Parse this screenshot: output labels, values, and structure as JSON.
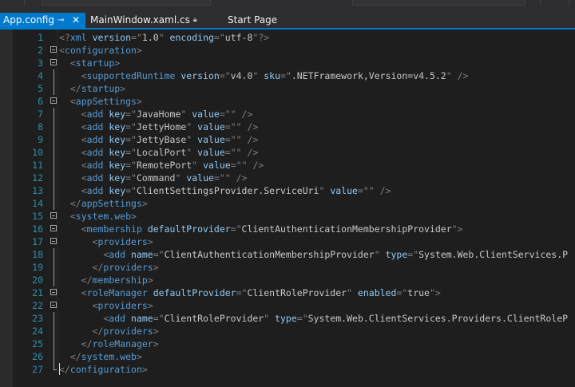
{
  "tabs": [
    {
      "label": "App.config",
      "active": true,
      "pinned": true,
      "closable": true
    },
    {
      "label": "MainWindow.xaml.cs",
      "active": false,
      "read_only": true
    },
    {
      "label": "Start Page",
      "active": false
    }
  ],
  "icons": {
    "pin": "pin-icon",
    "close": "close-icon",
    "lock": "lock-icon"
  },
  "colors": {
    "accent": "#007acc",
    "background": "#1e1e1e",
    "line_number": "#2b91af",
    "tag": "#569cd6",
    "attribute": "#92caf4",
    "delimiter": "#808080",
    "text": "#c8c8c8"
  },
  "editor": {
    "caret_line": 27,
    "lines": [
      {
        "n": "1",
        "fold": "",
        "indent": 0,
        "tokens": [
          [
            "d",
            "<?"
          ],
          [
            "t",
            "xml"
          ],
          [
            "a",
            " version"
          ],
          [
            "d",
            "=\""
          ],
          [
            "v",
            "1.0"
          ],
          [
            "d",
            "\""
          ],
          [
            "a",
            " encoding"
          ],
          [
            "d",
            "=\""
          ],
          [
            "v",
            "utf-8"
          ],
          [
            "d",
            "\"?>"
          ]
        ]
      },
      {
        "n": "2",
        "fold": "open",
        "indent": 0,
        "tokens": [
          [
            "d",
            "<"
          ],
          [
            "t",
            "configuration"
          ],
          [
            "d",
            ">"
          ]
        ]
      },
      {
        "n": "3",
        "fold": "open",
        "indent": 1,
        "tokens": [
          [
            "d",
            "<"
          ],
          [
            "t",
            "startup"
          ],
          [
            "d",
            ">"
          ]
        ]
      },
      {
        "n": "4",
        "fold": "",
        "indent": 2,
        "tokens": [
          [
            "d",
            "<"
          ],
          [
            "t",
            "supportedRuntime"
          ],
          [
            "a",
            " version"
          ],
          [
            "d",
            "=\""
          ],
          [
            "v",
            "v4.0"
          ],
          [
            "d",
            "\""
          ],
          [
            "a",
            " sku"
          ],
          [
            "d",
            "=\""
          ],
          [
            "v",
            ".NETFramework,Version=v4.5.2"
          ],
          [
            "d",
            "\" />"
          ]
        ]
      },
      {
        "n": "5",
        "fold": "",
        "indent": 1,
        "tokens": [
          [
            "d",
            "</"
          ],
          [
            "t",
            "startup"
          ],
          [
            "d",
            ">"
          ]
        ]
      },
      {
        "n": "6",
        "fold": "open",
        "indent": 1,
        "tokens": [
          [
            "d",
            "<"
          ],
          [
            "t",
            "appSettings"
          ],
          [
            "d",
            ">"
          ]
        ]
      },
      {
        "n": "7",
        "fold": "",
        "indent": 2,
        "tokens": [
          [
            "d",
            "<"
          ],
          [
            "t",
            "add"
          ],
          [
            "a",
            " key"
          ],
          [
            "d",
            "=\""
          ],
          [
            "v",
            "JavaHome"
          ],
          [
            "d",
            "\""
          ],
          [
            "a",
            " value"
          ],
          [
            "d",
            "=\"\" />"
          ]
        ]
      },
      {
        "n": "8",
        "fold": "",
        "indent": 2,
        "tokens": [
          [
            "d",
            "<"
          ],
          [
            "t",
            "add"
          ],
          [
            "a",
            " key"
          ],
          [
            "d",
            "=\""
          ],
          [
            "v",
            "JettyHome"
          ],
          [
            "d",
            "\""
          ],
          [
            "a",
            " value"
          ],
          [
            "d",
            "=\"\" />"
          ]
        ]
      },
      {
        "n": "9",
        "fold": "",
        "indent": 2,
        "tokens": [
          [
            "d",
            "<"
          ],
          [
            "t",
            "add"
          ],
          [
            "a",
            " key"
          ],
          [
            "d",
            "=\""
          ],
          [
            "v",
            "JettyBase"
          ],
          [
            "d",
            "\""
          ],
          [
            "a",
            " value"
          ],
          [
            "d",
            "=\"\" />"
          ]
        ]
      },
      {
        "n": "10",
        "fold": "",
        "indent": 2,
        "tokens": [
          [
            "d",
            "<"
          ],
          [
            "t",
            "add"
          ],
          [
            "a",
            " key"
          ],
          [
            "d",
            "=\""
          ],
          [
            "v",
            "LocalPort"
          ],
          [
            "d",
            "\""
          ],
          [
            "a",
            " value"
          ],
          [
            "d",
            "=\"\" />"
          ]
        ]
      },
      {
        "n": "11",
        "fold": "",
        "indent": 2,
        "tokens": [
          [
            "d",
            "<"
          ],
          [
            "t",
            "add"
          ],
          [
            "a",
            " key"
          ],
          [
            "d",
            "=\""
          ],
          [
            "v",
            "RemotePort"
          ],
          [
            "d",
            "\""
          ],
          [
            "a",
            " value"
          ],
          [
            "d",
            "=\"\" />"
          ]
        ]
      },
      {
        "n": "12",
        "fold": "",
        "indent": 2,
        "tokens": [
          [
            "d",
            "<"
          ],
          [
            "t",
            "add"
          ],
          [
            "a",
            " key"
          ],
          [
            "d",
            "=\""
          ],
          [
            "v",
            "Command"
          ],
          [
            "d",
            "\""
          ],
          [
            "a",
            " value"
          ],
          [
            "d",
            "=\"\" />"
          ]
        ]
      },
      {
        "n": "13",
        "fold": "",
        "indent": 2,
        "tokens": [
          [
            "d",
            "<"
          ],
          [
            "t",
            "add"
          ],
          [
            "a",
            " key"
          ],
          [
            "d",
            "=\""
          ],
          [
            "v",
            "ClientSettingsProvider.ServiceUri"
          ],
          [
            "d",
            "\""
          ],
          [
            "a",
            " value"
          ],
          [
            "d",
            "=\"\" />"
          ]
        ]
      },
      {
        "n": "14",
        "fold": "",
        "indent": 1,
        "tokens": [
          [
            "d",
            "</"
          ],
          [
            "t",
            "appSettings"
          ],
          [
            "d",
            ">"
          ]
        ]
      },
      {
        "n": "15",
        "fold": "open",
        "indent": 1,
        "tokens": [
          [
            "d",
            "<"
          ],
          [
            "t",
            "system.web"
          ],
          [
            "d",
            ">"
          ]
        ]
      },
      {
        "n": "16",
        "fold": "open",
        "indent": 2,
        "tokens": [
          [
            "d",
            "<"
          ],
          [
            "t",
            "membership"
          ],
          [
            "a",
            " defaultProvider"
          ],
          [
            "d",
            "=\""
          ],
          [
            "v",
            "ClientAuthenticationMembershipProvider"
          ],
          [
            "d",
            "\">"
          ]
        ]
      },
      {
        "n": "17",
        "fold": "open",
        "indent": 3,
        "tokens": [
          [
            "d",
            "<"
          ],
          [
            "t",
            "providers"
          ],
          [
            "d",
            ">"
          ]
        ]
      },
      {
        "n": "18",
        "fold": "",
        "indent": 4,
        "tokens": [
          [
            "d",
            "<"
          ],
          [
            "t",
            "add"
          ],
          [
            "a",
            " name"
          ],
          [
            "d",
            "=\""
          ],
          [
            "v",
            "ClientAuthenticationMembershipProvider"
          ],
          [
            "d",
            "\""
          ],
          [
            "a",
            " type"
          ],
          [
            "d",
            "=\""
          ],
          [
            "v",
            "System.Web.ClientServices.P"
          ]
        ]
      },
      {
        "n": "19",
        "fold": "",
        "indent": 3,
        "tokens": [
          [
            "d",
            "</"
          ],
          [
            "t",
            "providers"
          ],
          [
            "d",
            ">"
          ]
        ]
      },
      {
        "n": "20",
        "fold": "",
        "indent": 2,
        "tokens": [
          [
            "d",
            "</"
          ],
          [
            "t",
            "membership"
          ],
          [
            "d",
            ">"
          ]
        ]
      },
      {
        "n": "21",
        "fold": "open",
        "indent": 2,
        "tokens": [
          [
            "d",
            "<"
          ],
          [
            "t",
            "roleManager"
          ],
          [
            "a",
            " defaultProvider"
          ],
          [
            "d",
            "=\""
          ],
          [
            "v",
            "ClientRoleProvider"
          ],
          [
            "d",
            "\""
          ],
          [
            "a",
            " enabled"
          ],
          [
            "d",
            "=\""
          ],
          [
            "v",
            "true"
          ],
          [
            "d",
            "\">"
          ]
        ]
      },
      {
        "n": "22",
        "fold": "open",
        "indent": 3,
        "tokens": [
          [
            "d",
            "<"
          ],
          [
            "t",
            "providers"
          ],
          [
            "d",
            ">"
          ]
        ]
      },
      {
        "n": "23",
        "fold": "",
        "indent": 4,
        "tokens": [
          [
            "d",
            "<"
          ],
          [
            "t",
            "add"
          ],
          [
            "a",
            " name"
          ],
          [
            "d",
            "=\""
          ],
          [
            "v",
            "ClientRoleProvider"
          ],
          [
            "d",
            "\""
          ],
          [
            "a",
            " type"
          ],
          [
            "d",
            "=\""
          ],
          [
            "v",
            "System.Web.ClientServices.Providers.ClientRoleP"
          ]
        ]
      },
      {
        "n": "24",
        "fold": "",
        "indent": 3,
        "tokens": [
          [
            "d",
            "</"
          ],
          [
            "t",
            "providers"
          ],
          [
            "d",
            ">"
          ]
        ]
      },
      {
        "n": "25",
        "fold": "",
        "indent": 2,
        "tokens": [
          [
            "d",
            "</"
          ],
          [
            "t",
            "roleManager"
          ],
          [
            "d",
            ">"
          ]
        ]
      },
      {
        "n": "26",
        "fold": "",
        "indent": 1,
        "tokens": [
          [
            "d",
            "</"
          ],
          [
            "t",
            "system.web"
          ],
          [
            "d",
            ">"
          ]
        ]
      },
      {
        "n": "27",
        "fold": "",
        "indent": 0,
        "tokens": [
          [
            "d",
            "</"
          ],
          [
            "t",
            "configuration"
          ],
          [
            "d",
            ">"
          ]
        ]
      }
    ]
  }
}
